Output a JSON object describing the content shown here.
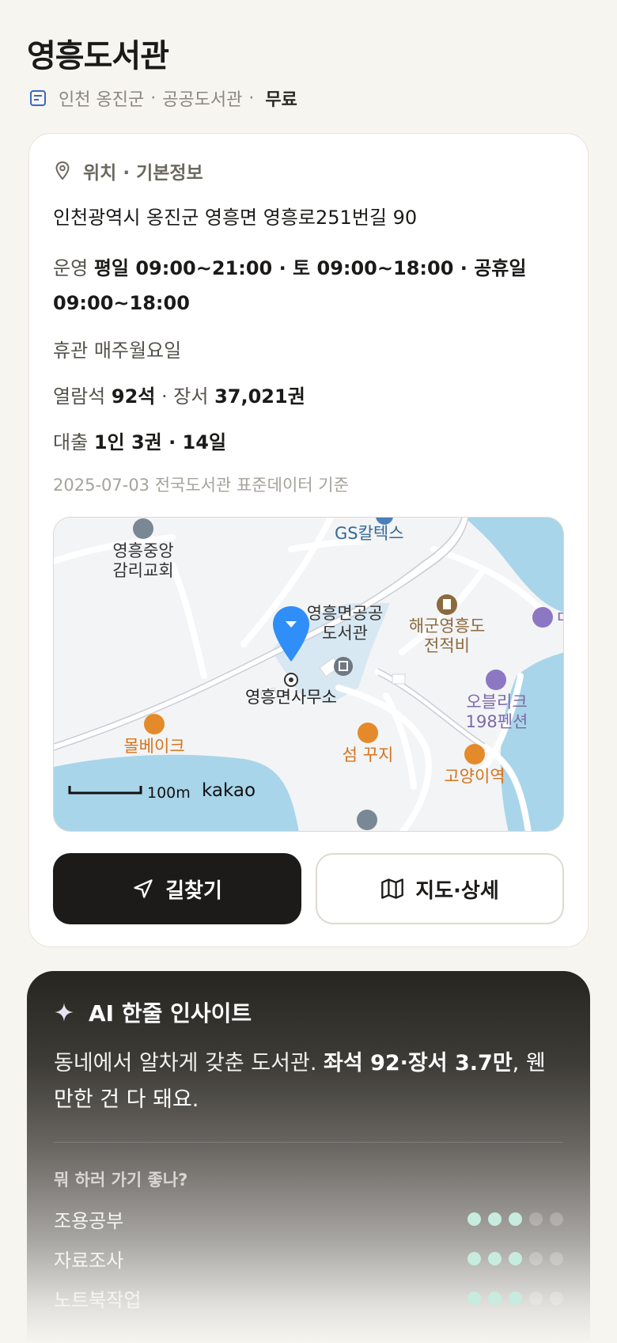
{
  "header": {
    "title": "영흥도서관",
    "location": "인천 옹진군",
    "category": "공공도서관",
    "fee": "무료",
    "sep": "·"
  },
  "info": {
    "section_title": "위치 · 기본정보",
    "address": "인천광역시 옹진군 영흥면 영흥로251번길 90",
    "hours_label": "운영",
    "hours_value": "평일 09:00~21:00 · 토 09:00~18:00 · 공휴일 09:00~18:00",
    "closed_label": "휴관",
    "closed_value": "매주월요일",
    "seats_label": "열람석",
    "seats_value": "92석",
    "books_sep": " · ",
    "books_label": "장서",
    "books_value": "37,021권",
    "loan_label": "대출",
    "loan_value": "1인 3권 · 14일",
    "source": "2025-07-03 전국도서관 표준데이터 기준"
  },
  "map": {
    "labels": {
      "church": "영흥중앙\n감리교회",
      "gas": "GS칼텍스",
      "library": "영흥면공공\n도서관",
      "monument": "해군영흥도\n전적비",
      "office": "영흥면사무소",
      "pension": "오블리크\n198펜션",
      "cafe1": "몰베이크",
      "cafe2": "섬 꾸지",
      "cafe3": "고양이역",
      "partial": "ㅁ"
    },
    "scale": "100m",
    "brand": "kakao",
    "colors": {
      "water": "#a8d5e9",
      "pin": "#2f8ef7",
      "cafe": "#e58a2a",
      "place": "#7d6aa8"
    }
  },
  "actions": {
    "directions": "길찾기",
    "map_detail": "지도·상세"
  },
  "ai": {
    "title": "AI 한줄 인사이트",
    "text_plain": "동네에서 알차게 갖춘 도서관. ",
    "text_bold": "좌석 92·장서 3.7만",
    "text_end": ", 웬만한 건 다 돼요.",
    "question": "뭐 하러 가기 좋나?",
    "activities": [
      {
        "name": "조용공부",
        "level": 3,
        "max": 5
      },
      {
        "name": "자료조사",
        "level": 3,
        "max": 5
      },
      {
        "name": "노트북작업",
        "level": 3,
        "max": 5
      }
    ]
  }
}
